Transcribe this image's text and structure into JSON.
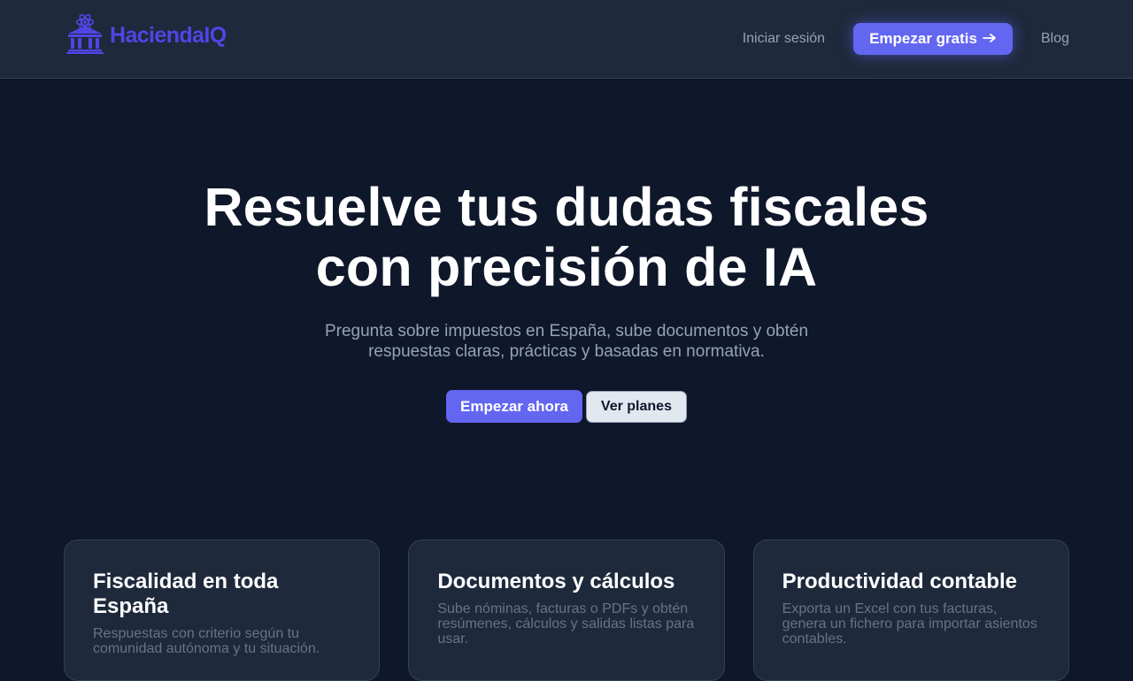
{
  "brand": {
    "name": "HaciendaIQ",
    "logo_icon": "government-building-atom-icon",
    "color": "#4f46e5"
  },
  "nav": {
    "login_label": "Iniciar sesión",
    "cta_label": "Empezar gratis",
    "cta_icon": "arrow-right-icon",
    "blog_label": "Blog"
  },
  "hero": {
    "title_line1": "Resuelve tus dudas fiscales",
    "title_line2": "con precisión de IA",
    "subtitle": "Pregunta sobre impuestos en España, sube documentos y obtén respuestas claras, prácticas y basadas en normativa.",
    "primary_cta": "Empezar ahora",
    "secondary_cta": "Ver planes"
  },
  "features": [
    {
      "title": "Fiscalidad en toda España",
      "text": "Respuestas con criterio según tu comunidad autónoma y tu situación."
    },
    {
      "title": "Documentos y cálculos",
      "text": "Sube nóminas, facturas o PDFs y obtén resúmenes, cálculos y salidas listas para usar."
    },
    {
      "title": "Productividad contable",
      "text": "Exporta un Excel con tus facturas, genera un fichero para importar asientos contables."
    }
  ],
  "colors": {
    "background": "#0f172a",
    "surface": "#1e293b",
    "accent": "#6366f1",
    "muted_text": "#94a3b8"
  }
}
